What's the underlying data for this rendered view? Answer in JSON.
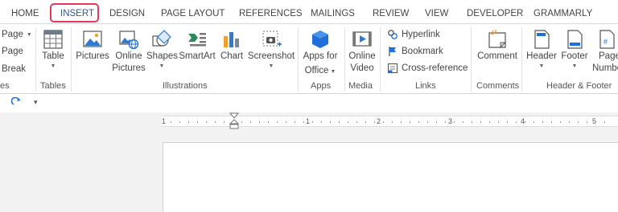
{
  "tabs": [
    {
      "label": "HOME"
    },
    {
      "label": "INSERT"
    },
    {
      "label": "DESIGN"
    },
    {
      "label": "PAGE LAYOUT"
    },
    {
      "label": "REFERENCES"
    },
    {
      "label": "MAILINGS"
    },
    {
      "label": "REVIEW"
    },
    {
      "label": "VIEW"
    },
    {
      "label": "DEVELOPER"
    },
    {
      "label": "GRAMMARLY"
    }
  ],
  "active_tab": "INSERT",
  "pages_group": {
    "items": [
      "Page",
      "Page",
      "Break"
    ],
    "label": "es"
  },
  "tables_group": {
    "table_label": "Table",
    "label": "Tables"
  },
  "illustrations_group": {
    "pictures": "Pictures",
    "online_pictures_line1": "Online",
    "online_pictures_line2": "Pictures",
    "shapes": "Shapes",
    "smartart": "SmartArt",
    "chart": "Chart",
    "screenshot": "Screenshot",
    "label": "Illustrations"
  },
  "apps_group": {
    "line1": "Apps for",
    "line2": "Office",
    "label": "Apps"
  },
  "media_group": {
    "line1": "Online",
    "line2": "Video",
    "label": "Media"
  },
  "links_group": {
    "hyperlink": "Hyperlink",
    "bookmark": "Bookmark",
    "cross_reference": "Cross-reference",
    "label": "Links"
  },
  "comments_group": {
    "comment": "Comment",
    "label": "Comments"
  },
  "header_footer_group": {
    "header": "Header",
    "footer": "Footer",
    "page_number_line1": "Page",
    "page_number_line2": "Numbe",
    "label": "Header & Footer"
  },
  "ruler": {
    "numbers": [
      "1",
      "1",
      "2",
      "3",
      "4",
      "5"
    ]
  },
  "colors": {
    "accent": "#2b579a",
    "highlight": "#e8365d",
    "app_blue": "#1e6fd9"
  }
}
